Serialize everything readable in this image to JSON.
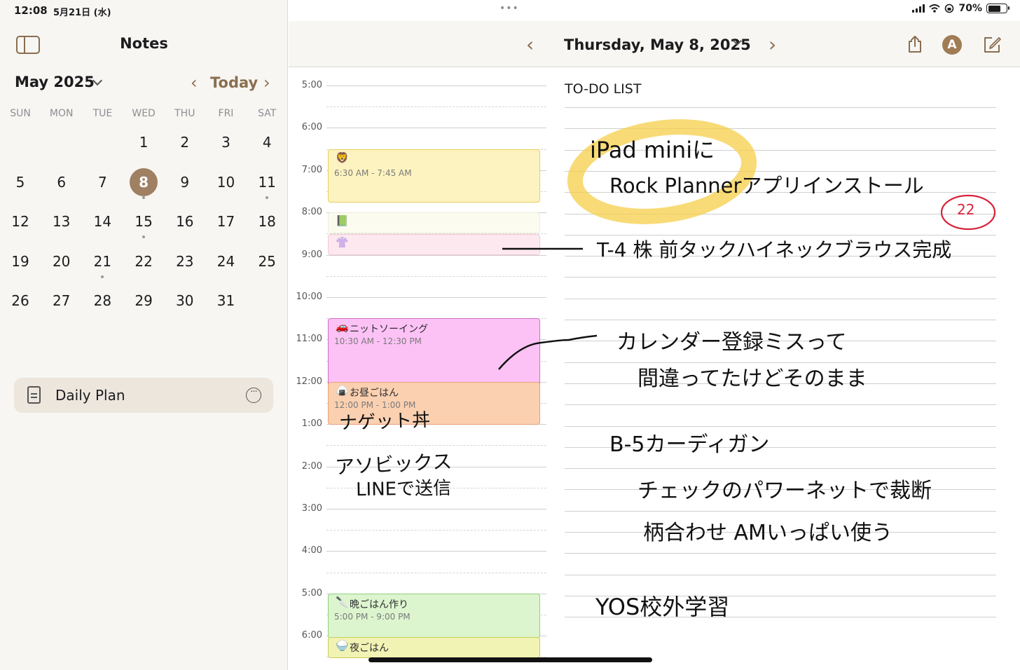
{
  "status_bar": {
    "time": "12:08",
    "date": "5月21日 (水)",
    "battery": "70%"
  },
  "sidebar": {
    "title": "Notes",
    "month_label": "May 2025",
    "today_label": "Today",
    "weekdays": [
      "SUN",
      "MON",
      "TUE",
      "WED",
      "THU",
      "FRI",
      "SAT"
    ],
    "days": [
      "1",
      "2",
      "3",
      "4",
      "5",
      "6",
      "7",
      "8",
      "9",
      "10",
      "11",
      "12",
      "13",
      "14",
      "15",
      "16",
      "17",
      "18",
      "19",
      "20",
      "21",
      "22",
      "23",
      "24",
      "25",
      "26",
      "27",
      "28",
      "29",
      "30",
      "31"
    ],
    "selected_day": "8",
    "note_item": {
      "label": "Daily Plan"
    }
  },
  "header": {
    "date_title": "Thursday, May 8, 2025",
    "avatar_letter": "A"
  },
  "planner": {
    "times": [
      "5:00",
      "6:00",
      "7:00",
      "8:00",
      "9:00",
      "10:00",
      "11:00",
      "12:00",
      "1:00",
      "2:00",
      "3:00",
      "4:00",
      "5:00",
      "6:00"
    ],
    "todo_title": "TO-DO LIST",
    "events": [
      {
        "emoji": "🦁",
        "title": "",
        "time": "6:30 AM - 7:45 AM",
        "color": "#fdf3c0",
        "border": "#e9cf5a"
      },
      {
        "emoji": "📗",
        "title": "",
        "time": "",
        "color": "#fbfbf0",
        "border": "#eeeeda"
      },
      {
        "emoji": "👚",
        "title": "",
        "time": "",
        "color": "#fde8ef",
        "border": "#f2c8d6"
      },
      {
        "emoji": "🚗",
        "title": "ニットソーイング",
        "time": "10:30 AM - 12:30 PM",
        "color": "#fdc2f5",
        "border": "#d270c8"
      },
      {
        "emoji": "🍙",
        "title": "お昼ごはん",
        "time": "12:00 PM - 1:00 PM",
        "color": "#fbd0b0",
        "border": "#e9a07a"
      },
      {
        "emoji": "🔪",
        "title": "晩ごはん作り",
        "time": "5:00 PM - 9:00 PM",
        "color": "#dcf5cf",
        "border": "#8fd07a"
      },
      {
        "emoji": "🍚",
        "title": "夜ごはん",
        "time": "",
        "color": "#f1f3b4",
        "border": "#c9cd5a"
      }
    ],
    "handwriting": {
      "left_lunch": "ナゲット丼",
      "left_note_1": "アソビックス",
      "left_note_2": "LINEで送信",
      "todo_1a": "iPad miniに",
      "todo_1b": "Rock Plannerアプリインストール",
      "todo_badge": "22",
      "todo_2": "T-4 株 前タックハイネックブラウス完成",
      "todo_3a": "カレンダー登録ミスって",
      "todo_3b": "間違ってたけどそのまま",
      "todo_4a": "B-5カーディガン",
      "todo_4b": "チェックのパワーネットで裁断",
      "todo_4c": "柄合わせ AMいっぱい使う",
      "todo_5": "YOS校外学習"
    }
  }
}
